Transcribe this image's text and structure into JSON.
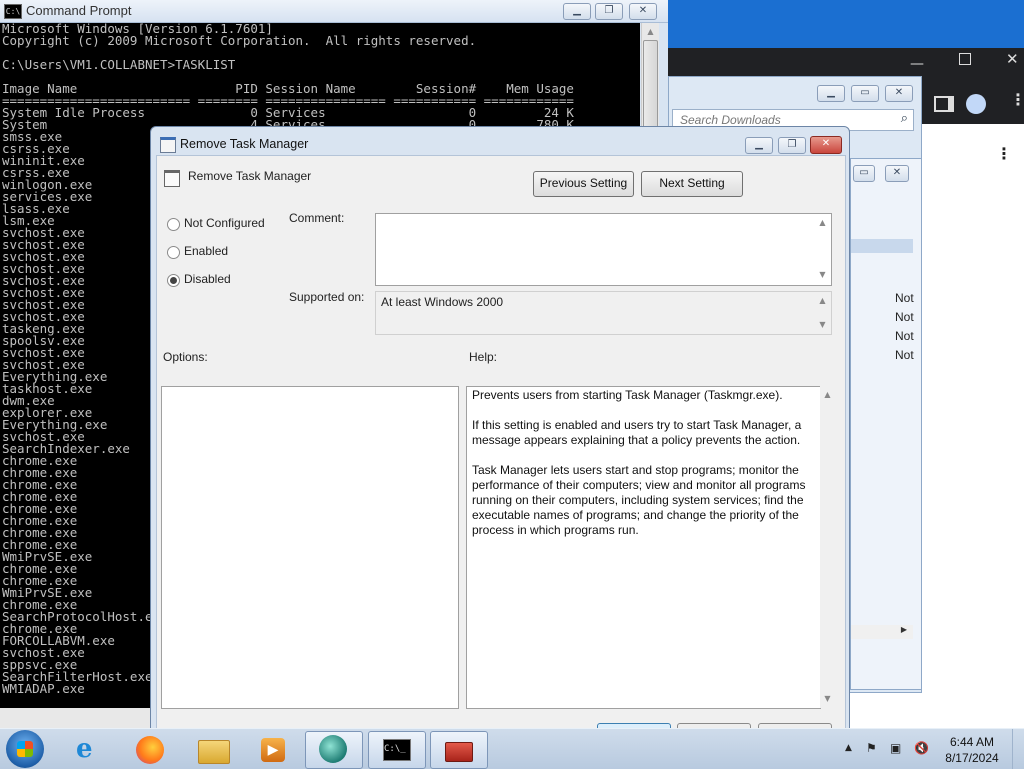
{
  "cmd": {
    "title": "Command Prompt",
    "icon": "C:\\",
    "console_text": "Microsoft Windows [Version 6.1.7601]\nCopyright (c) 2009 Microsoft Corporation.  All rights reserved.\n\nC:\\Users\\VM1.COLLABNET>TASKLIST\n\nImage Name                     PID Session Name        Session#    Mem Usage\n========================= ======== ================ =========== ============\nSystem Idle Process              0 Services                   0         24 K\nSystem                           4 Services                   0        780 K\nsmss.exe\ncsrss.exe\nwininit.exe\ncsrss.exe\nwinlogon.exe\nservices.exe\nlsass.exe\nlsm.exe\nsvchost.exe\nsvchost.exe\nsvchost.exe\nsvchost.exe\nsvchost.exe\nsvchost.exe\nsvchost.exe\nsvchost.exe\ntaskeng.exe\nspoolsv.exe\nsvchost.exe\nsvchost.exe\nEverything.exe\ntaskhost.exe\ndwm.exe\nexplorer.exe\nEverything.exe\nsvchost.exe\nSearchIndexer.exe\nchrome.exe\nchrome.exe\nchrome.exe\nchrome.exe\nchrome.exe\nchrome.exe\nchrome.exe\nchrome.exe\nWmiPrvSE.exe\nchrome.exe\nchrome.exe\nWmiPrvSE.exe\nchrome.exe\nSearchProtocolHost.exe\nchrome.exe\nFORCOLLABVM.exe\nsvchost.exe\nsppsvc.exe\nSearchFilterHost.exe\nWMIADAP.exe"
  },
  "explorer": {
    "search_placeholder": "Search Downloads",
    "status_values": [
      "Not",
      "Not",
      "Not",
      "Not"
    ]
  },
  "dialog": {
    "title": "Remove Task Manager",
    "setting_name": "Remove Task Manager",
    "previous_setting": "Previous Setting",
    "next_setting": "Next Setting",
    "radio_not_configured": "Not Configured",
    "radio_enabled": "Enabled",
    "radio_disabled": "Disabled",
    "selected_option": "Disabled",
    "comment_label": "Comment:",
    "comment_value": "",
    "supported_label": "Supported on:",
    "supported_value": "At least Windows 2000",
    "options_label": "Options:",
    "help_label": "Help:",
    "help_p1": "Prevents users from starting Task Manager (Taskmgr.exe).",
    "help_p2": "If this setting is enabled and users try to start Task Manager, a message appears explaining that a policy prevents the action.",
    "help_p3": "Task Manager lets users start and stop programs; monitor the performance of their computers; view and monitor all programs running on their computers, including system services; find the executable names of programs; and change the priority of the process in which programs run."
  },
  "taskbar": {
    "time": "6:44 AM",
    "date": "8/17/2024",
    "pinned": [
      "start-orb",
      "internet-explorer-icon",
      "firefox-icon",
      "file-explorer-icon",
      "media-player-icon",
      "app-icon",
      "command-prompt-icon",
      "control-panel-icon"
    ]
  },
  "colors": {
    "console_bg": "#000000",
    "console_fg": "#c0c0c0",
    "dialog_bg": "#f0f0f0",
    "taskbar": "#c6d6ea",
    "close_red": "#c9463d"
  }
}
